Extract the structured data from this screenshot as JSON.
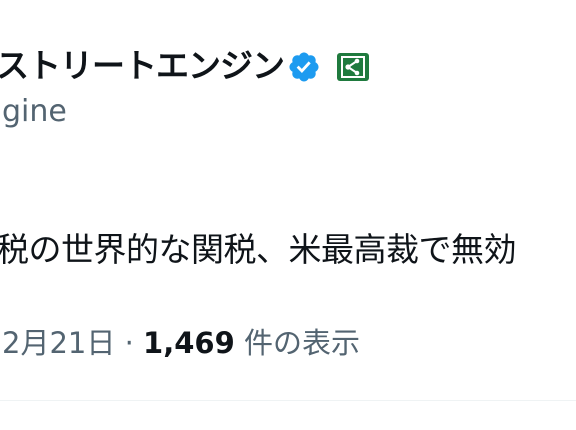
{
  "author": {
    "display_name": "ストリートエンジン",
    "handle": "gine",
    "verified_icon": "verified-checkmark-icon",
    "affiliate_icon": "affiliate-badge-icon"
  },
  "tweet": {
    "text": "税の世界的な関税、米最高裁で無効",
    "date": "2月21日",
    "separator": "·",
    "views_count": "1,469",
    "views_label": "件の表示"
  },
  "colors": {
    "text_primary": "#0f1419",
    "text_secondary": "#536471",
    "verified_blue": "#1d9bf0",
    "affiliate_green": "#1f7a3e",
    "divider": "#eff3f4"
  }
}
